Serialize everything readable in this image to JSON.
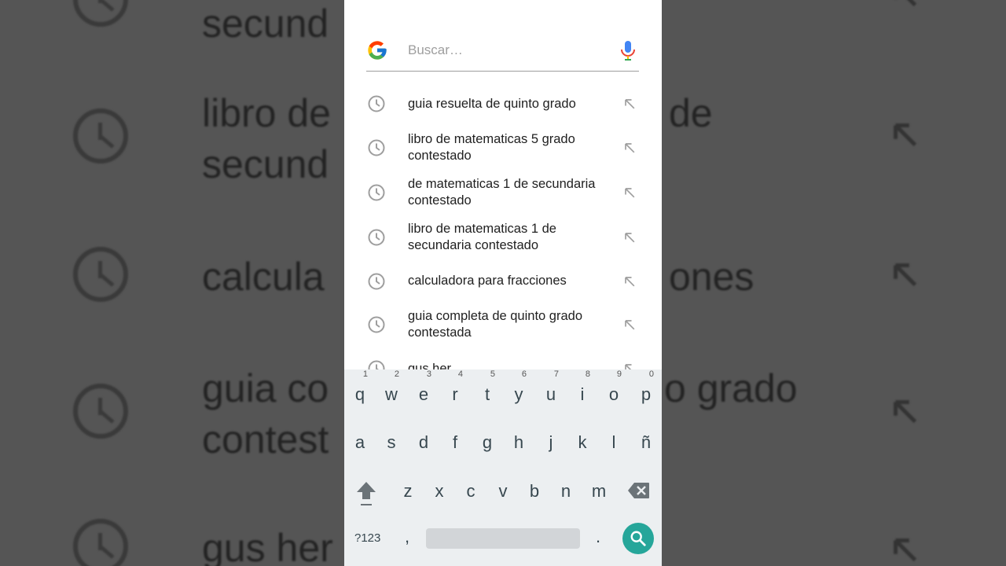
{
  "search": {
    "placeholder": "Buscar…",
    "value": ""
  },
  "suggestions": [
    {
      "text": "guia resuelta de quinto grado"
    },
    {
      "text": "libro de matematicas 5 grado contestado"
    },
    {
      "text": "de matematicas 1 de secundaria contestado"
    },
    {
      "text": "libro de matematicas 1 de secundaria contestado"
    },
    {
      "text": "calculadora para fracciones"
    },
    {
      "text": "guia completa de quinto grado contestada"
    },
    {
      "text": "gus her"
    }
  ],
  "background": {
    "lines": [
      {
        "text": "secund"
      },
      {
        "text": "libro de"
      },
      {
        "text": "secund"
      },
      {
        "text": "calcula"
      },
      {
        "text": "guia co"
      },
      {
        "text": "contest"
      },
      {
        "text": "gus her"
      }
    ],
    "right": [
      {
        "text": "de"
      },
      {
        "text": "ones"
      },
      {
        "text": "o grado"
      }
    ]
  },
  "keyboard": {
    "row1": [
      {
        "ch": "q",
        "hint": "1"
      },
      {
        "ch": "w",
        "hint": "2"
      },
      {
        "ch": "e",
        "hint": "3"
      },
      {
        "ch": "r",
        "hint": "4"
      },
      {
        "ch": "t",
        "hint": "5"
      },
      {
        "ch": "y",
        "hint": "6"
      },
      {
        "ch": "u",
        "hint": "7"
      },
      {
        "ch": "i",
        "hint": "8"
      },
      {
        "ch": "o",
        "hint": "9"
      },
      {
        "ch": "p",
        "hint": "0"
      }
    ],
    "row2": [
      "a",
      "s",
      "d",
      "f",
      "g",
      "h",
      "j",
      "k",
      "l",
      "ñ"
    ],
    "row3": [
      "z",
      "x",
      "c",
      "v",
      "b",
      "n",
      "m"
    ],
    "symbols_label": "?123",
    "comma": ",",
    "period": "."
  },
  "icons": {
    "logo": "google-g-icon",
    "mic": "microphone-icon",
    "history": "history-clock-icon",
    "fill": "arrow-up-left-icon",
    "shift": "shift-icon",
    "backspace": "backspace-icon",
    "search": "search-icon"
  },
  "colors": {
    "accent": "#26a69a",
    "keyboard_bg": "#eceff1",
    "text": "#212121",
    "placeholder": "#9e9e9e"
  }
}
